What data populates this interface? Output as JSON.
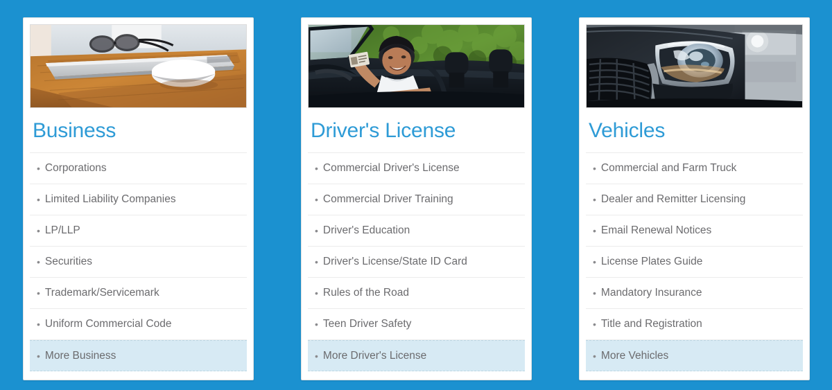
{
  "page": {
    "background_color": "#1b91d0",
    "card_background_color": "#ffffff",
    "title_color": "#2e9bd6",
    "item_text_color": "#6b6b6e",
    "highlight_color": "#d7eaf4",
    "bullet_glyph": "•"
  },
  "cards": [
    {
      "title": "Business",
      "image_name": "laptop-glasses-mouse-on-wooden-desk-photo",
      "image_alt": "Laptop with eyeglasses and a computer mouse on a wooden desk",
      "items": [
        {
          "label": "Corporations",
          "highlighted": false
        },
        {
          "label": "Limited Liability Companies",
          "highlighted": false
        },
        {
          "label": "LP/LLP",
          "highlighted": false
        },
        {
          "label": "Securities",
          "highlighted": false
        },
        {
          "label": "Trademark/Servicemark",
          "highlighted": false
        },
        {
          "label": "Uniform Commercial Code",
          "highlighted": false
        },
        {
          "label": "More Business",
          "highlighted": true
        }
      ]
    },
    {
      "title": "Driver's License",
      "image_name": "man-in-convertible-holding-license-photo",
      "image_alt": "Smiling man in a convertible car holding up a driver's license",
      "items": [
        {
          "label": "Commercial Driver's License",
          "highlighted": false
        },
        {
          "label": "Commercial Driver Training",
          "highlighted": false
        },
        {
          "label": "Driver's Education",
          "highlighted": false
        },
        {
          "label": "Driver's License/State ID Card",
          "highlighted": false
        },
        {
          "label": "Rules of the Road",
          "highlighted": false
        },
        {
          "label": "Teen Driver Safety",
          "highlighted": false
        },
        {
          "label": "More Driver's License",
          "highlighted": true
        }
      ]
    },
    {
      "title": "Vehicles",
      "image_name": "car-headlight-and-grille-closeup-photo",
      "image_alt": "Close-up of a dark car's headlight and front grille",
      "items": [
        {
          "label": "Commercial and Farm Truck",
          "highlighted": false
        },
        {
          "label": "Dealer and Remitter Licensing",
          "highlighted": false
        },
        {
          "label": "Email Renewal Notices",
          "highlighted": false
        },
        {
          "label": "License Plates Guide",
          "highlighted": false
        },
        {
          "label": "Mandatory Insurance",
          "highlighted": false
        },
        {
          "label": "Title and Registration",
          "highlighted": false
        },
        {
          "label": "More Vehicles",
          "highlighted": true
        }
      ]
    }
  ]
}
